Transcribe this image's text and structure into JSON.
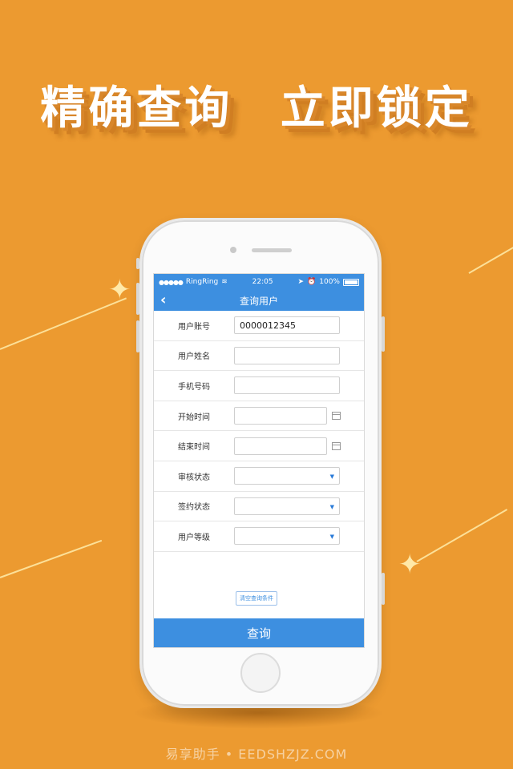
{
  "promo": {
    "headline_left": "精确查询",
    "headline_right": "立即锁定"
  },
  "status_bar": {
    "carrier": "RingRing",
    "time": "22:05",
    "battery": "100%"
  },
  "nav": {
    "title": "查询用户"
  },
  "form": {
    "rows": [
      {
        "label": "用户账号",
        "value": "0000012345"
      },
      {
        "label": "用户姓名",
        "value": ""
      },
      {
        "label": "手机号码",
        "value": ""
      },
      {
        "label": "开始时间",
        "value": ""
      },
      {
        "label": "结束时间",
        "value": ""
      },
      {
        "label": "审核状态",
        "value": ""
      },
      {
        "label": "签约状态",
        "value": ""
      },
      {
        "label": "用户等级",
        "value": ""
      }
    ],
    "clear_label": "清空查询条件",
    "submit_label": "查询"
  },
  "watermark": "易享助手 • EEDSHZJZ.COM",
  "colors": {
    "background": "#ec9a30",
    "accent": "#3d8fe0"
  },
  "icons": [
    "back-chevron",
    "wifi",
    "location",
    "alarm",
    "calendar",
    "dropdown-arrow",
    "sparkle"
  ]
}
